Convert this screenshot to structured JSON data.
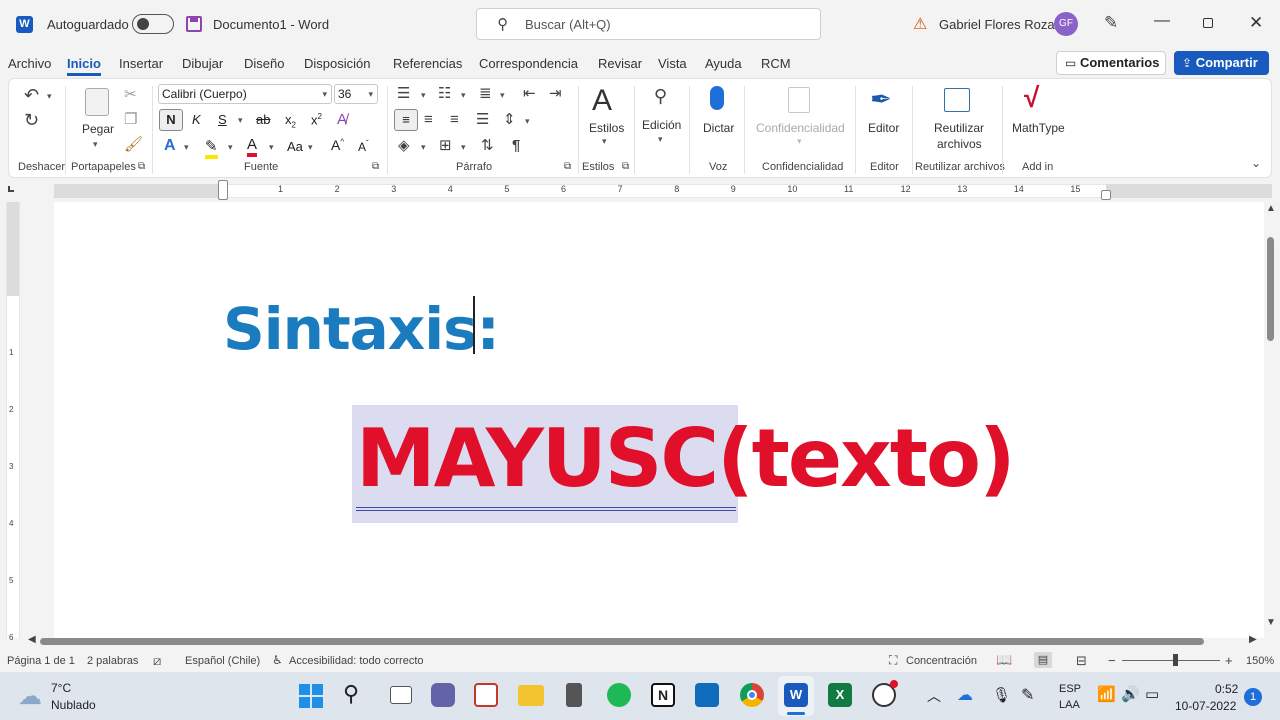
{
  "titlebar": {
    "autosave_label": "Autoguardado",
    "doc_title": "Documento1",
    "app_name": "Word",
    "search_placeholder": "Buscar (Alt+Q)",
    "user_name": "Gabriel Flores Rozas",
    "user_initials": "GF"
  },
  "tabs": [
    "Archivo",
    "Inicio",
    "Insertar",
    "Dibujar",
    "Diseño",
    "Disposición",
    "Referencias",
    "Correspondencia",
    "Revisar",
    "Vista",
    "Ayuda",
    "RCM"
  ],
  "active_tab": "Inicio",
  "actions": {
    "comments": "Comentarios",
    "share": "Compartir"
  },
  "ribbon": {
    "undo_group": "Deshacer",
    "clipboard": {
      "paste": "Pegar",
      "label": "Portapapeles"
    },
    "font": {
      "name": "Calibri (Cuerpo)",
      "size": "36",
      "bold": "N",
      "italic": "K",
      "underline": "S",
      "case_btn": "Aa",
      "label": "Fuente"
    },
    "paragraph": {
      "label": "Párrafo"
    },
    "styles": {
      "button": "Estilos",
      "label": "Estilos"
    },
    "editing": {
      "button": "Edición"
    },
    "voice": {
      "button": "Dictar",
      "label": "Voz"
    },
    "sensitivity": {
      "button": "Confidencialidad",
      "label": "Confidencialidad"
    },
    "editor": {
      "button": "Editor",
      "label": "Editor"
    },
    "reuse": {
      "button_line1": "Reutilizar",
      "button_line2": "archivos",
      "label": "Reutilizar archivos"
    },
    "addin": {
      "button": "MathType",
      "label": "Add in"
    }
  },
  "ruler_numbers": [
    "1",
    "2",
    "3",
    "4",
    "5",
    "6",
    "7",
    "8",
    "9",
    "10",
    "11",
    "12",
    "13",
    "14",
    "15"
  ],
  "vruler_numbers": [
    "1",
    "2",
    "3",
    "4",
    "5",
    "6"
  ],
  "document": {
    "heading": "Sintaxis:",
    "formula_selected": "MAYUSC(",
    "formula_rest": "texto)",
    "colors": {
      "heading": "#1a7bbf",
      "formula": "#e0102a",
      "selection": "#dcdcf0"
    }
  },
  "status": {
    "page": "Página 1 de 1",
    "words": "2 palabras",
    "language": "Español (Chile)",
    "accessibility": "Accesibilidad: todo correcto",
    "focus": "Concentración",
    "zoom": "150%"
  },
  "taskbar": {
    "weather_temp": "7°C",
    "weather_desc": "Nublado",
    "lang_top": "ESP",
    "lang_bottom": "LAA",
    "time": "0:52",
    "date": "10-07-2022",
    "notif_count": "1"
  }
}
